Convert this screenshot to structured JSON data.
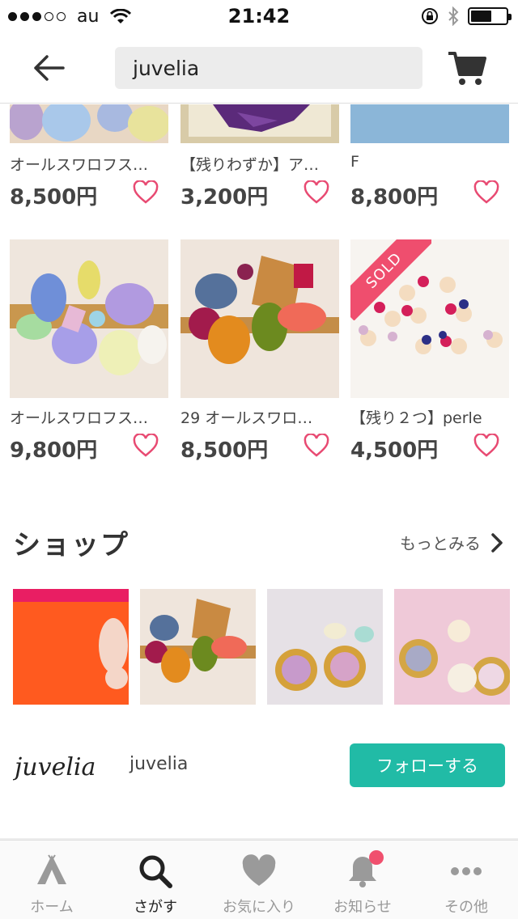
{
  "status_bar": {
    "carrier": "au",
    "time": "21:42",
    "signal_bars_filled": 3,
    "signal_bars_total": 5,
    "battery_level": 0.6
  },
  "header": {
    "search_value": "juvelia",
    "back_icon": "arrow-left-icon",
    "cart_icon": "cart-icon"
  },
  "products": [
    {
      "title": "オールスワロフス…",
      "price": "8,500円",
      "sold": false,
      "image": "crystal-bracelet-opal"
    },
    {
      "title": "【残りわずか】ア…",
      "price": "3,200円",
      "sold": false,
      "image": "amethyst-frame"
    },
    {
      "title": "F",
      "price": "8,800円",
      "sold": false,
      "image": "blue-item"
    },
    {
      "title": "オールスワロフス…",
      "price": "9,800円",
      "sold": false,
      "image": "crystal-cluster-pastel"
    },
    {
      "title": "29 オールスワロ…",
      "price": "8,500円",
      "sold": false,
      "image": "crystal-cluster-amber"
    },
    {
      "title": "【残り２つ】perle",
      "price": "4,500円",
      "sold": true,
      "sold_label": "SOLD",
      "image": "crystal-earrings"
    }
  ],
  "shop_section": {
    "title": "ショップ",
    "more_label": "もっとみる",
    "thumbnails": [
      "orange-book",
      "crystal-cluster-amber",
      "opal-studs",
      "flower-pearl-studs"
    ],
    "shop_name": "juvelia",
    "logo_text": "juvelia",
    "follow_label": "フォローする"
  },
  "tabs": [
    {
      "label": "ホーム",
      "icon": "tent-icon",
      "active": false
    },
    {
      "label": "さがす",
      "icon": "search-icon",
      "active": true
    },
    {
      "label": "お気に入り",
      "icon": "heart-icon",
      "active": false
    },
    {
      "label": "お知らせ",
      "icon": "bell-icon",
      "active": false,
      "badge": true
    },
    {
      "label": "その他",
      "icon": "more-icon",
      "active": false
    }
  ],
  "colors": {
    "accent_heart": "#e84a72",
    "follow_button": "#21bba6",
    "sold_ribbon": "#ef4e6e",
    "badge": "#f0506e"
  }
}
